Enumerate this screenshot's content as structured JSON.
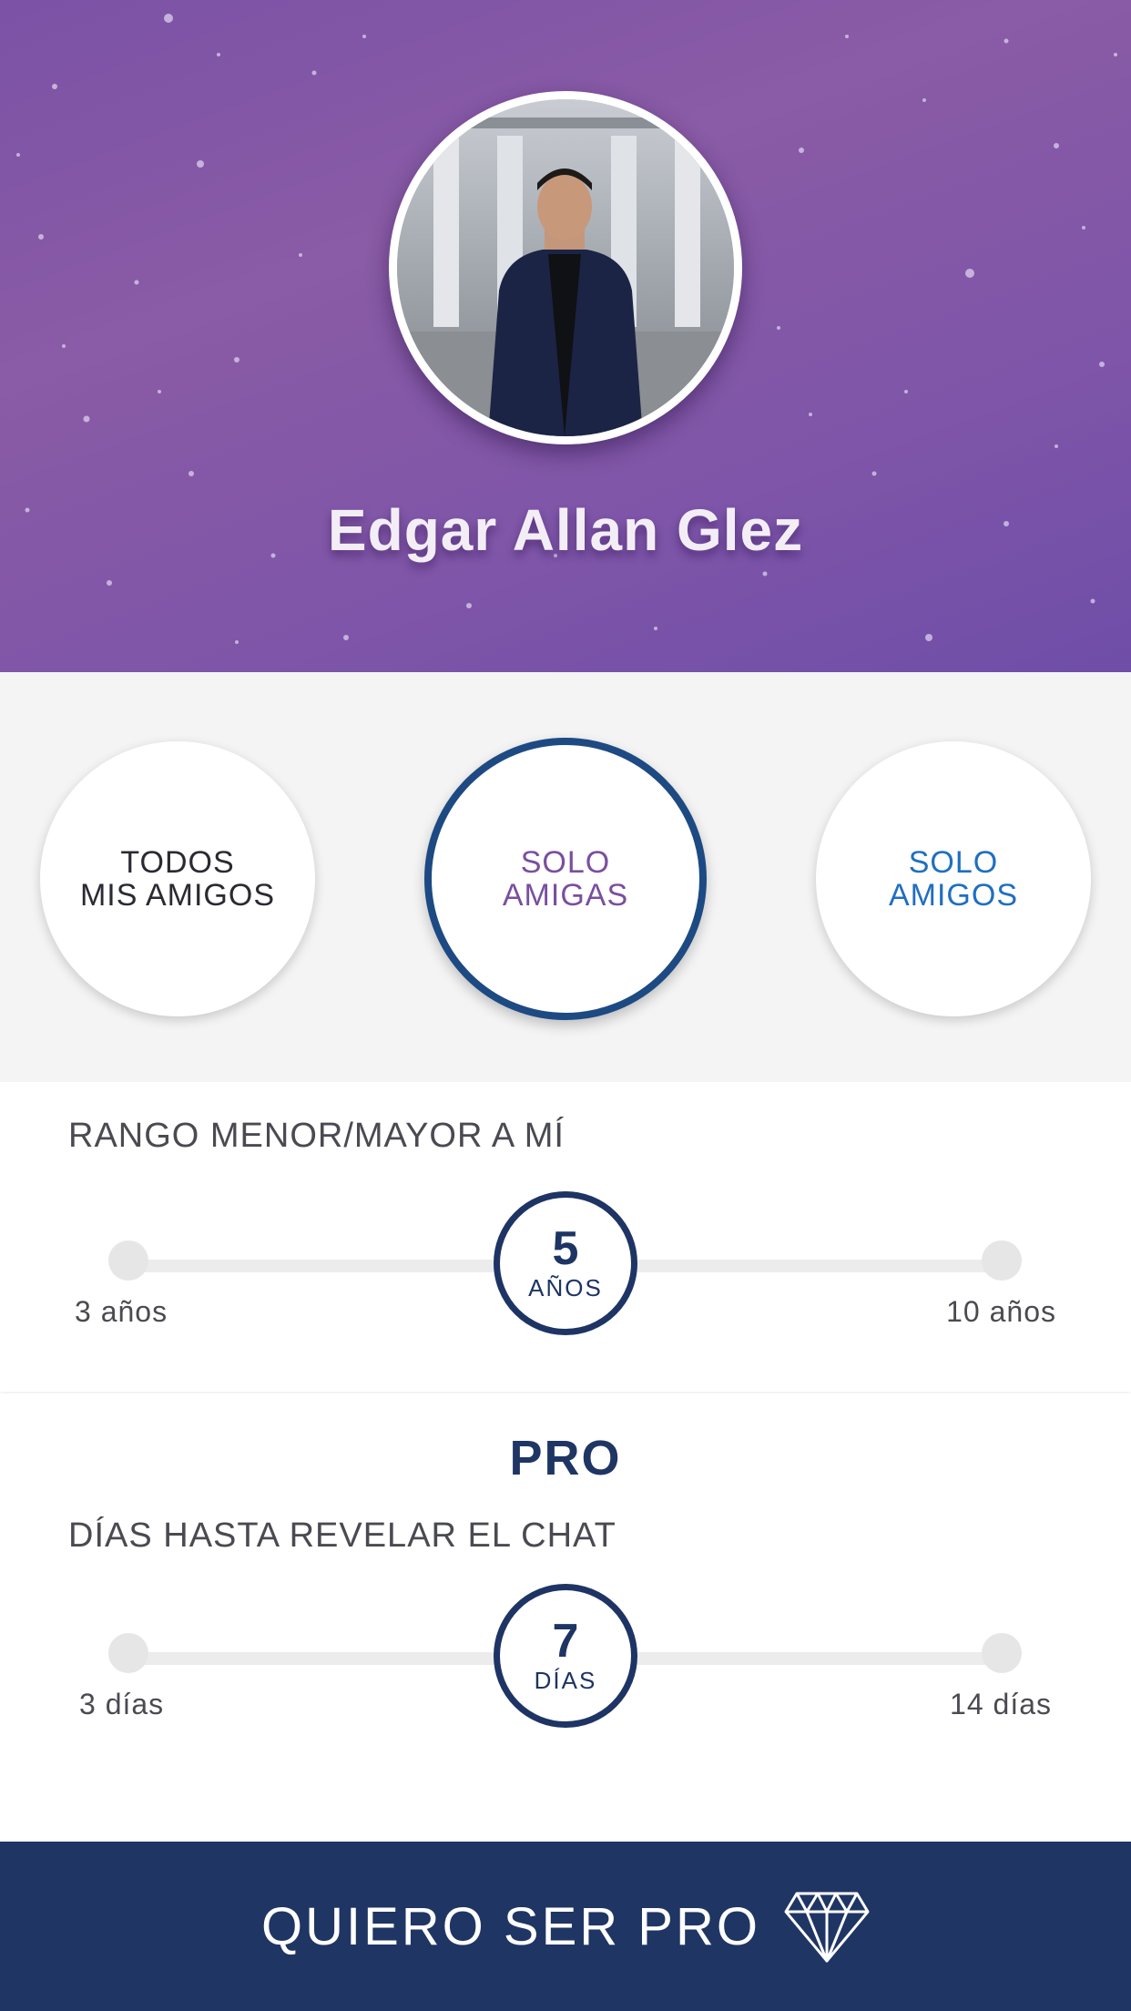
{
  "profile": {
    "name": "Edgar Allan Glez",
    "avatar_icon": "profile-photo"
  },
  "filter": {
    "options": [
      {
        "line1": "TODOS",
        "line2": "MIS AMIGOS",
        "color": "#2a2a33",
        "selected": false
      },
      {
        "line1": "SOLO",
        "line2": "AMIGAS",
        "color": "#7a4f9e",
        "selected": true
      },
      {
        "line1": "SOLO",
        "line2": "AMIGOS",
        "color": "#1f6fc0",
        "selected": false
      }
    ]
  },
  "age_range": {
    "label": "RANGO MENOR/MAYOR A MÍ",
    "value": "5",
    "unit": "AÑOS",
    "min_label": "3 años",
    "max_label": "10 años"
  },
  "pro": {
    "title": "PRO",
    "label": "DÍAS HASTA REVELAR EL CHAT",
    "value": "7",
    "unit": "DÍAS",
    "min_label": "3 días",
    "max_label": "14 días"
  },
  "cta": {
    "label": "QUIERO SER PRO",
    "icon": "diamond-icon"
  },
  "colors": {
    "header_purple": "#8a5ba6",
    "navy": "#1f3563",
    "selected_ring": "#1d4a82"
  }
}
